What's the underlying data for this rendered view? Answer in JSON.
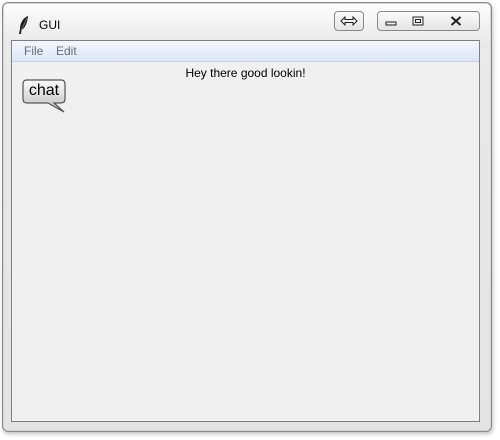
{
  "window": {
    "title": "GUI",
    "icons": {
      "app": "feather-icon",
      "move": "double-arrow-icon",
      "minimize": "minimize-icon",
      "maximize": "maximize-icon",
      "close": "close-icon"
    }
  },
  "menubar": {
    "items": [
      {
        "label": "File"
      },
      {
        "label": "Edit"
      }
    ]
  },
  "content": {
    "greeting": "Hey there good lookin!",
    "chat_button": {
      "label": "chat",
      "icon": "speech-bubble-icon"
    }
  }
}
